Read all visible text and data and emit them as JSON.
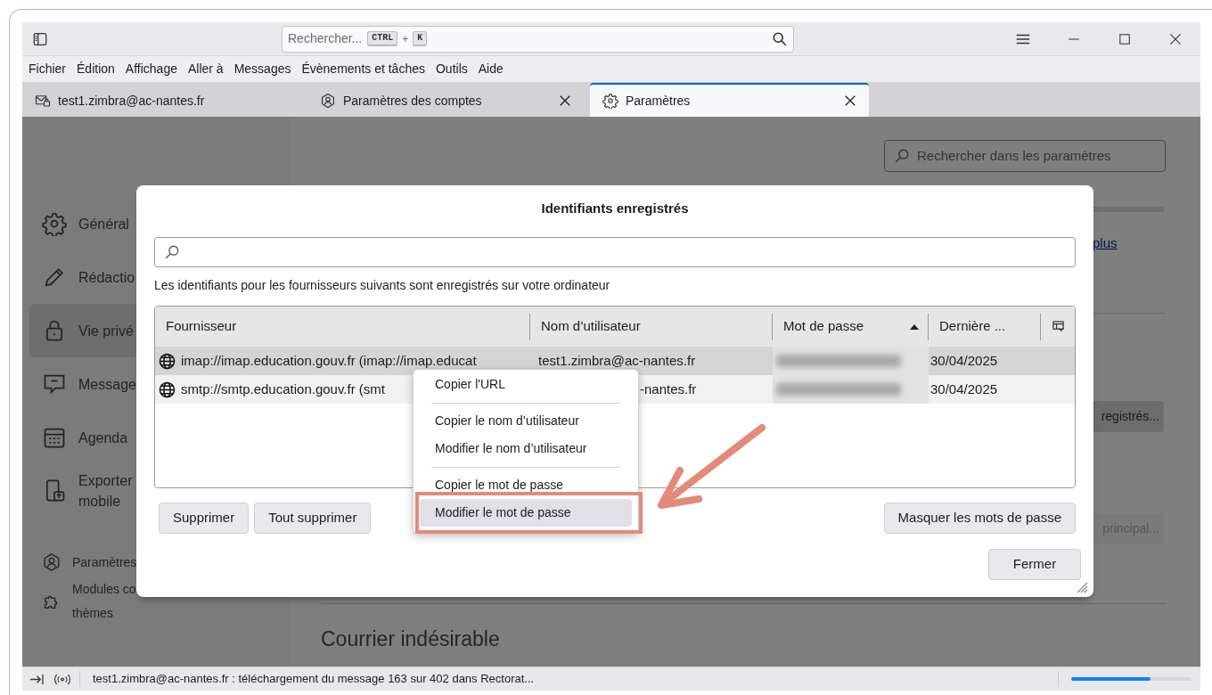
{
  "title_bar": {
    "search": {
      "placeholder": "Rechercher...",
      "keys": [
        "CTRL",
        "K"
      ],
      "key_joiner": "+"
    }
  },
  "menu_bar": [
    {
      "label": "Fichier"
    },
    {
      "label": "Édition"
    },
    {
      "label": "Affichage"
    },
    {
      "label": "Aller à"
    },
    {
      "label": "Messages"
    },
    {
      "label": "Évènements et tâches"
    },
    {
      "label": "Outils"
    },
    {
      "label": "Aide"
    }
  ],
  "tabs": [
    {
      "label": "test1.zimbra@ac-nantes.fr",
      "selected": false,
      "closable": false
    },
    {
      "label": "Paramètres des comptes",
      "selected": false,
      "closable": true
    },
    {
      "label": "Paramètres",
      "selected": true,
      "closable": true
    }
  ],
  "sidebar": {
    "items": [
      {
        "lines": [
          "Général"
        ],
        "selected": false
      },
      {
        "lines": [
          "Rédactio"
        ],
        "selected": false
      },
      {
        "lines": [
          "Vie privé"
        ],
        "selected": true
      },
      {
        "lines": [
          "Message"
        ],
        "selected": false
      },
      {
        "lines": [
          "Agenda"
        ],
        "selected": false
      },
      {
        "lines": [
          "Exporter",
          "mobile"
        ],
        "selected": false
      }
    ],
    "footer_items": [
      {
        "lines": [
          "Paramètres"
        ]
      },
      {
        "lines": [
          "Modules co",
          "thèmes"
        ]
      }
    ]
  },
  "settings_page": {
    "search_placeholder": "Rechercher dans les paramètres",
    "link": "plus",
    "buttons": [
      {
        "label": "registrés...",
        "disabled": false
      },
      {
        "label": "principal...",
        "disabled": true
      }
    ],
    "section_heading": "Courrier indésirable"
  },
  "dialog": {
    "title": "Identifiants enregistrés",
    "description": "Les identifiants pour les fournisseurs suivants sont enregistrés sur votre ordinateur",
    "columns": [
      {
        "label": "Fournisseur",
        "sorted": false
      },
      {
        "label": "Nom d’utilisateur",
        "sorted": false
      },
      {
        "label": "Mot de passe",
        "sorted": true
      },
      {
        "label": "Dernière ...",
        "sorted": false
      }
    ],
    "rows": [
      {
        "provider": "imap://imap.education.gouv.fr (imap://imap.educat",
        "username": "test1.zimbra@ac-nantes.fr",
        "date": "30/04/2025",
        "selected": true
      },
      {
        "provider": "smtp://smtp.education.gouv.fr (smt",
        "username": "-nantes.fr",
        "date": "30/04/2025",
        "selected": false
      }
    ],
    "left_buttons": [
      {
        "label": "Supprimer"
      },
      {
        "label": "Tout supprimer"
      }
    ],
    "toggle_button": {
      "label": "Masquer les mots de passe"
    },
    "close_button": {
      "label": "Fermer"
    }
  },
  "context_menu": {
    "items": [
      {
        "kind": "item",
        "label": "Copier l'URL",
        "selected": false
      },
      {
        "kind": "separator"
      },
      {
        "kind": "item",
        "label": "Copier le nom d’utilisateur",
        "selected": false
      },
      {
        "kind": "item",
        "label": "Modifier le nom d’utilisateur",
        "selected": false
      },
      {
        "kind": "separator"
      },
      {
        "kind": "item",
        "label": "Copier le mot de passe",
        "selected": false
      },
      {
        "kind": "item",
        "label": "Modifier le mot de passe",
        "selected": true
      }
    ]
  },
  "status_bar": {
    "text": "test1.zimbra@ac-nantes.fr : téléchargement du message 163 sur 402 dans Rectorat...",
    "progress": {
      "level": 0.66
    }
  }
}
